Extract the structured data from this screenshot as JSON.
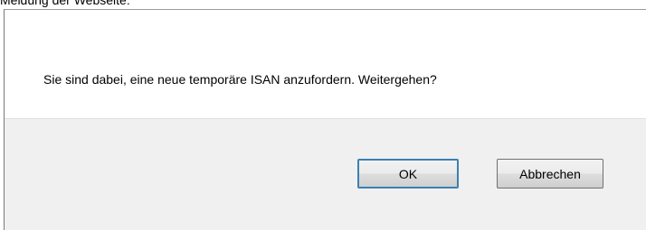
{
  "window": {
    "title": "Meldung der Webseite:"
  },
  "dialog": {
    "message": "Sie sind dabei, eine neue temporäre ISAN anzufordern. Weitergehen?",
    "buttons": {
      "ok_label": "OK",
      "cancel_label": "Abbrechen"
    }
  },
  "colors": {
    "message_background": "#ffffff",
    "button_bar_background": "#f0f0f0",
    "focus_border": "#3c7fb1"
  }
}
